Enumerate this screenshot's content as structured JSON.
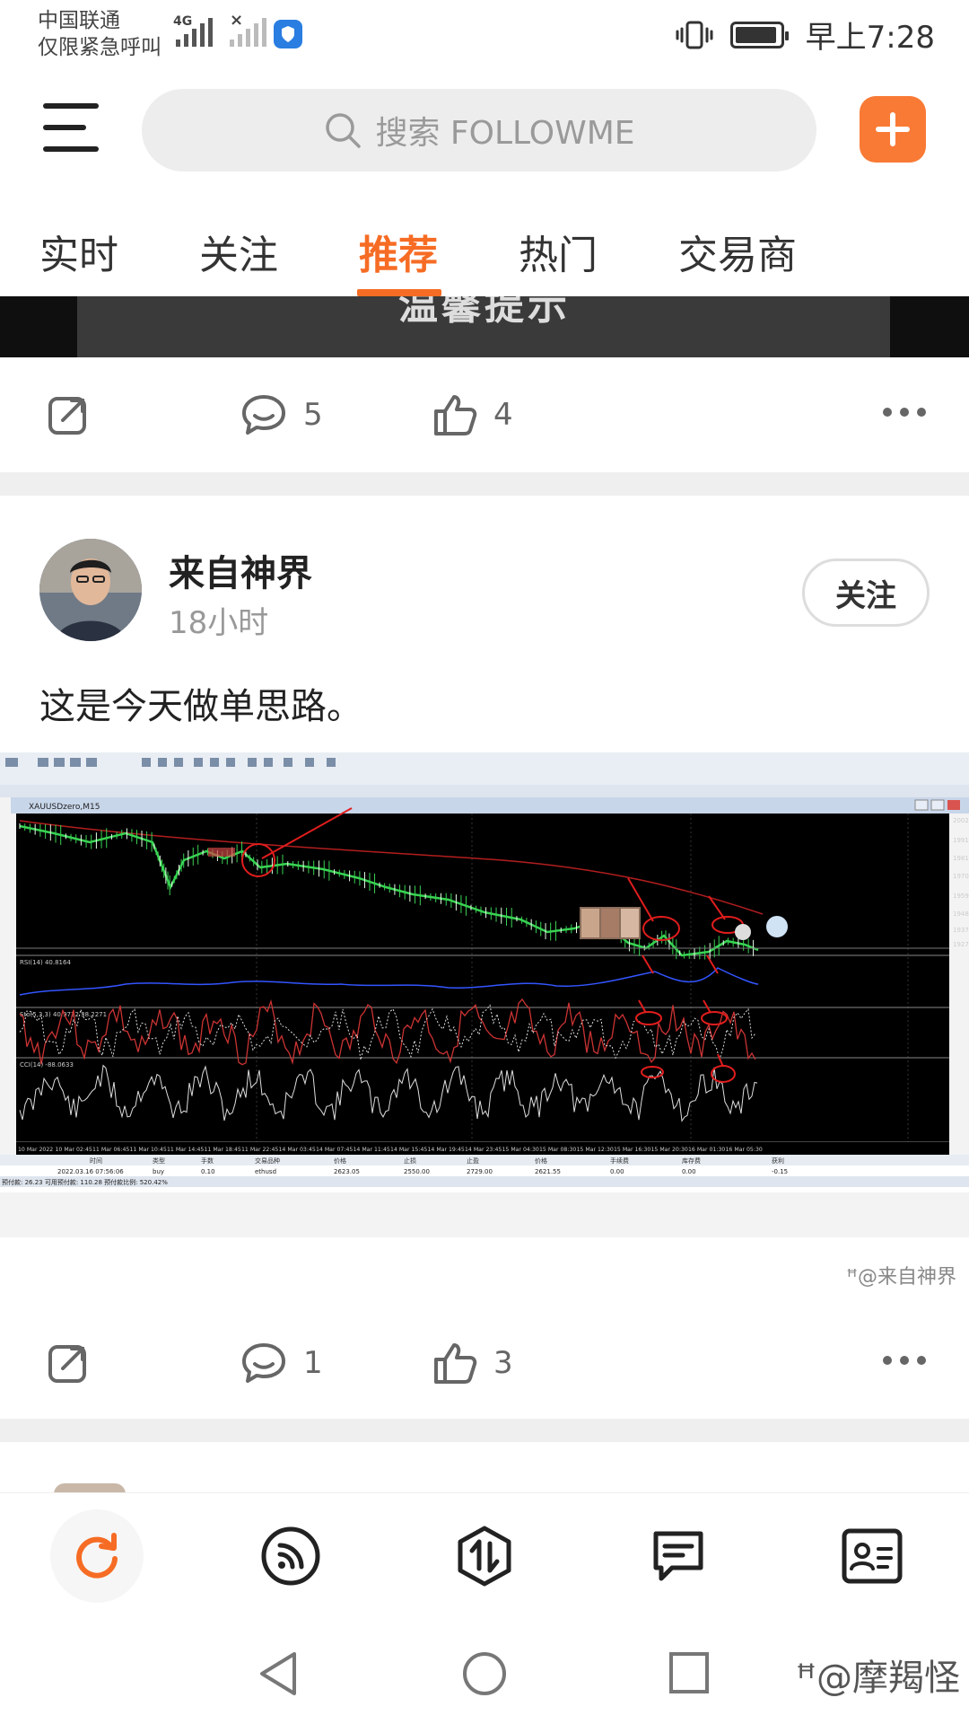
{
  "status_bar": {
    "carrier_line1": "中国联通",
    "carrier_line2": "仅限紧急呼叫",
    "network_type": "4G",
    "time": "早上7:28"
  },
  "header": {
    "search_placeholder": "搜索 FOLLOWME"
  },
  "tabs": [
    {
      "label": "实时",
      "active": false
    },
    {
      "label": "关注",
      "active": false
    },
    {
      "label": "推荐",
      "active": true
    },
    {
      "label": "热门",
      "active": false
    },
    {
      "label": "交易商",
      "active": false
    }
  ],
  "banner": {
    "text": "温馨提示"
  },
  "posts": [
    {
      "comments": "5",
      "likes": "4"
    },
    {
      "author": "来自神界",
      "time": "18小时",
      "follow_label": "关注",
      "text": "这是今天做单思路。",
      "image": {
        "window_title": "XAUUSDzero,M15",
        "watermark": "@来自神界",
        "indicators": [
          "RSI(14) 40.8164",
          "Sto(5,3,3) 40.9722 38.2271",
          "CCI(14) -88.0633"
        ],
        "trade_row": [
          "2022.03.16 07:56:06",
          "buy",
          "0.10",
          "ethusd",
          "2623.05",
          "2550.00",
          "2729.00",
          "2621.55",
          "0.00",
          "0.00",
          "-0.15"
        ],
        "columns": [
          "时间",
          "类型",
          "手数",
          "交易品种",
          "价格",
          "止损",
          "止盈",
          "价格",
          "手续费",
          "库存费",
          "获利"
        ],
        "balance_line": "预付款: 26.23  可用预付款: 110.28  预付款比例: 520.42%",
        "x_labels": [
          "10 Mar 2022",
          "10 Mar 02:45",
          "11 Mar 06:45",
          "11 Mar 10:45",
          "11 Mar 14:45",
          "11 Mar 18:45",
          "11 Mar 22:45",
          "14 Mar 03:45",
          "14 Mar 07:45",
          "14 Mar 11:45",
          "14 Mar 15:45",
          "14 Mar 19:45",
          "14 Mar 23:45",
          "15 Mar 04:30",
          "15 Mar 08:30",
          "15 Mar 12:30",
          "15 Mar 16:30",
          "15 Mar 20:30",
          "16 Mar 01:30",
          "16 Mar 05:30"
        ]
      },
      "comments": "1",
      "likes": "3"
    }
  ],
  "system_watermark": "@摩羯怪",
  "colors": {
    "accent": "#f66c24",
    "add_button": "#f97a35",
    "chart_bg": "#000000",
    "candle_green": "#39d353",
    "annotation_red": "#e11d1d"
  }
}
